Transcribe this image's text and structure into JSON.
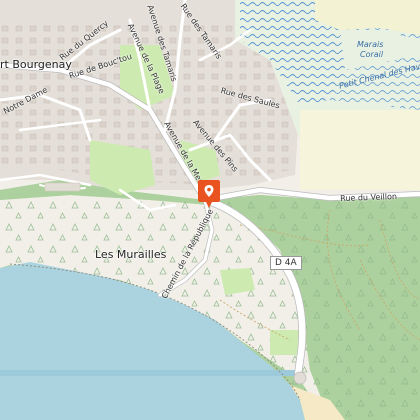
{
  "map": {
    "places": {
      "port_bourgenay": "rt Bourgenay",
      "les_murailles": "Les Murailles",
      "marais_corail_line1": "Marais",
      "marais_corail_line2": "Corail"
    },
    "streets": {
      "rue_du_quercy": "Rue du Quercy",
      "rue_de_bouctou": "Rue de Bouc'tou",
      "notre_dame": "Notre Dame",
      "avenue_de_la_plage": "Avenue de la Plage",
      "avenue_des_tamaris_a": "Avenue des Tamaris",
      "rue_des_tamaris": "Rue des Tamaris",
      "rue_des_saules": "Rue des Saules",
      "avenue_des_pins": "Avenue des Pins",
      "avenue_de_la_mer": "Avenue de la Mer",
      "rue_du_veillon": "Rue du Veillon",
      "chemin_de_la_republique": "Chemin de la République",
      "petit_chenal": "Petit Chenal des Hav"
    },
    "road_shield": "D 4A",
    "marker": {
      "icon": "map-pin-icon",
      "color": "#e8531f"
    },
    "colors": {
      "land": "#f2efe9",
      "sea": "#aad3df",
      "forest": "#add19e",
      "grass": "#cdebb0",
      "marsh": "#e7f0d6",
      "road": "#ffffff",
      "sand": "#f5e9c6"
    }
  }
}
